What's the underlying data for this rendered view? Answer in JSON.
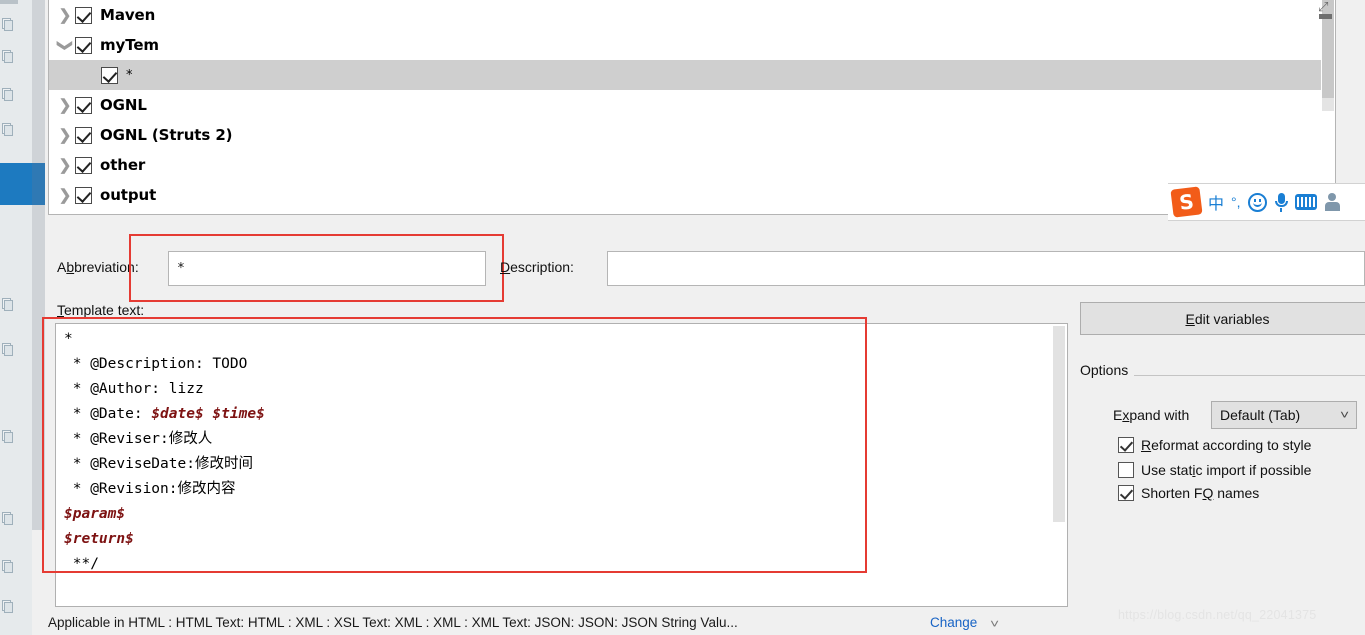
{
  "tree": {
    "rows": [
      {
        "label": "Maven",
        "arrow": "right",
        "checked": true,
        "indent": 0,
        "selected": false,
        "bold": true
      },
      {
        "label": "myTem",
        "arrow": "down",
        "checked": true,
        "indent": 0,
        "selected": false,
        "bold": true
      },
      {
        "label": "*",
        "arrow": "none",
        "checked": true,
        "indent": 1,
        "selected": true,
        "bold": false
      },
      {
        "label": "OGNL",
        "arrow": "right",
        "checked": true,
        "indent": 0,
        "selected": false,
        "bold": true
      },
      {
        "label": "OGNL (Struts 2)",
        "arrow": "right",
        "checked": true,
        "indent": 0,
        "selected": false,
        "bold": true
      },
      {
        "label": "other",
        "arrow": "right",
        "checked": true,
        "indent": 0,
        "selected": false,
        "bold": true
      },
      {
        "label": "output",
        "arrow": "right",
        "checked": true,
        "indent": 0,
        "selected": false,
        "bold": true
      }
    ]
  },
  "ime": {
    "logo_text": "S",
    "mode_label": "中",
    "punct_label": "°,",
    "items": [
      "sogou-logo",
      "chinese-mode",
      "punctuation",
      "emoji",
      "voice-input",
      "soft-keyboard",
      "user-account"
    ]
  },
  "fields": {
    "abbreviation_label": "Abbreviation:",
    "abbreviation_value": "*",
    "abbreviation_placeholder": "",
    "description_label": "Description:",
    "description_value": "",
    "description_placeholder": "",
    "template_text_label": "Template text:"
  },
  "template_text": {
    "lines": [
      [
        {
          "t": "*",
          "var": false
        }
      ],
      [
        {
          "t": " * @Description: TODO",
          "var": false
        }
      ],
      [
        {
          "t": " * @Author: lizz",
          "var": false
        }
      ],
      [
        {
          "t": " * @Date: ",
          "var": false
        },
        {
          "t": "$date$ $time$",
          "var": true
        }
      ],
      [
        {
          "t": " * @Reviser:修改人",
          "var": false
        }
      ],
      [
        {
          "t": " * @ReviseDate:修改时间",
          "var": false
        }
      ],
      [
        {
          "t": " * @Revision:修改内容",
          "var": false
        }
      ],
      [
        {
          "t": "$param$",
          "var": true
        }
      ],
      [
        {
          "t": "$return$",
          "var": true
        }
      ],
      [
        {
          "t": " **/",
          "var": false
        }
      ]
    ],
    "variable_color": "#7d1212"
  },
  "options": {
    "edit_variables_label": "Edit variables",
    "edit_variables_mnemonic": "E",
    "title": "Options",
    "expand_with_label": "Expand with",
    "expand_with_mnemonic": "x",
    "expand_with_value": "Default (Tab)",
    "checkboxes": [
      {
        "label": "Reformat according to style",
        "checked": true,
        "mnemonic": "R"
      },
      {
        "label": "Use static import if possible",
        "checked": false,
        "mnemonic": "i"
      },
      {
        "label": "Shorten FQ names",
        "checked": true,
        "mnemonic": "Q"
      }
    ]
  },
  "status": {
    "applicable_text": "Applicable in HTML : HTML Text: HTML : XML : XSL Text: XML : XML : XML Text: JSON: JSON: JSON String Valu...",
    "change_label": "Change"
  },
  "watermark": {
    "text": "https://blog.csdn.net/qq_22041375"
  },
  "colors": {
    "accent_blue": "#1d7ac0",
    "red_highlight": "#e53b33",
    "link_blue": "#1763c5",
    "variable_red": "#7d1212",
    "selection_gray": "#cfcfcf",
    "panel_bg": "#f0f0f0"
  }
}
